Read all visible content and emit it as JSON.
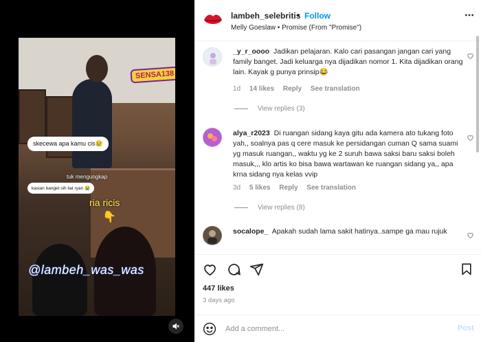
{
  "header": {
    "username": "lambeh_selebritis",
    "separator": "•",
    "follow_label": "Follow",
    "music": "Melly Goeslaw • Promise (From \"Promise\")",
    "more_icon": "more-horizontal-icon"
  },
  "video": {
    "sticker": "SENSA138",
    "bubble1": "skecewa apa kamu cis😢",
    "caption1": "tuk mengungkap",
    "bubble2": "kasian banget sih liat ryan 😭",
    "caption2": "ria ricis",
    "pointer": "👇",
    "watermark": "@lambeh_was_was",
    "mute_icon": "muted-speaker-icon"
  },
  "comments": [
    {
      "username": "_y_r_oooo",
      "text": "Jadikan pelajaran. Kalo cari pasangan jangan cari yang family banget. Jadi keluarga nya dijadikan nomor 1. Kita dijadikan orang lain. Kayak g punya prinsip😂",
      "time": "1d",
      "likes": "14 likes",
      "reply": "Reply",
      "translate": "See translation",
      "view_replies": "View replies (3)",
      "avatar_color": "#e9eef5"
    },
    {
      "username": "alya_r2023",
      "text": "Di ruangan sidang kaya gitu ada kamera ato tukang foto yah,, soalnya pas q cere masuk ke persidangan cuman Q sama suami yg masuk ruangan,, waktu yg ke 2 suruh bawa saksi baru saksi boleh masuk,,, klo artis ko bisa bawa wartawan ke ruangan sidang ya,, apa krna sidang nya kelas vvip",
      "time": "3d",
      "likes": "5 likes",
      "reply": "Reply",
      "translate": "See translation",
      "view_replies": "View replies (8)",
      "avatar_color": "#c97fd6"
    },
    {
      "username": "socalope_",
      "text": "Apakah sudah lama sakit hatinya..sampe ga mau rujuk",
      "avatar_color": "#7a6a5a"
    }
  ],
  "actions": {
    "like_icon": "heart-icon",
    "comment_icon": "comment-icon",
    "share_icon": "paper-plane-icon",
    "save_icon": "bookmark-icon"
  },
  "likes": "447 likes",
  "date": "3 days ago",
  "add_comment": {
    "placeholder": "Add a comment...",
    "post_label": "Post",
    "emoji_icon": "smiley-icon"
  },
  "colors": {
    "accent": "#0095f6",
    "text": "#262626",
    "muted": "#8e8e8e"
  }
}
